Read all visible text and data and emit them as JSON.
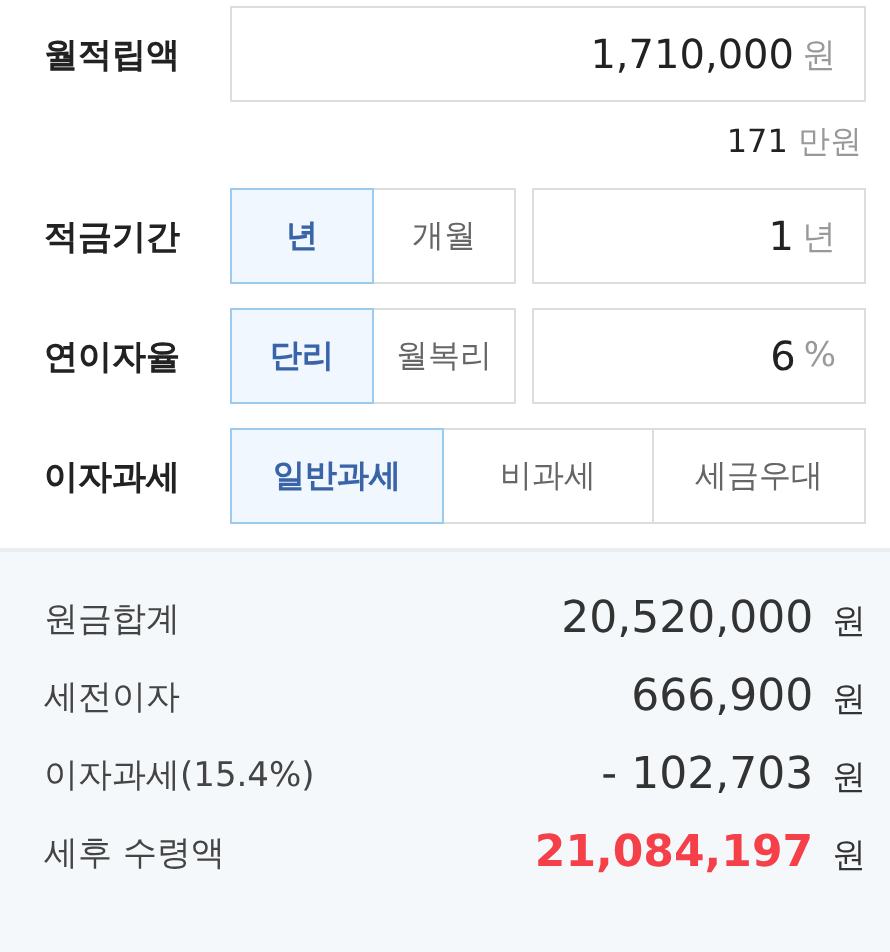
{
  "fields": [
    {
      "kind": "input",
      "label": "월적립액",
      "value": "1,710,000",
      "unit": "원",
      "hint": {
        "value": "171",
        "unit": "만원"
      }
    },
    {
      "kind": "segmented_input",
      "label": "적금기간",
      "options": [
        {
          "label": "년",
          "selected": true
        },
        {
          "label": "개월",
          "selected": false
        }
      ],
      "value": "1",
      "unit": "년"
    },
    {
      "kind": "segmented_input",
      "label": "연이자율",
      "options": [
        {
          "label": "단리",
          "selected": true
        },
        {
          "label": "월복리",
          "selected": false
        }
      ],
      "value": "6",
      "unit": "%"
    },
    {
      "kind": "segmented",
      "label": "이자과세",
      "options": [
        {
          "label": "일반과세",
          "selected": true
        },
        {
          "label": "비과세",
          "selected": false
        },
        {
          "label": "세금우대",
          "selected": false
        }
      ]
    }
  ],
  "results": [
    {
      "label": "원금합계",
      "value": "20,520,000",
      "unit": "원",
      "highlight": false
    },
    {
      "label": "세전이자",
      "value": "666,900",
      "unit": "원",
      "highlight": false
    },
    {
      "label": "이자과세(15.4%)",
      "value": "- 102,703",
      "unit": "원",
      "highlight": false
    },
    {
      "label": "세후 수령액",
      "value": "21,084,197",
      "unit": "원",
      "highlight": true
    }
  ]
}
